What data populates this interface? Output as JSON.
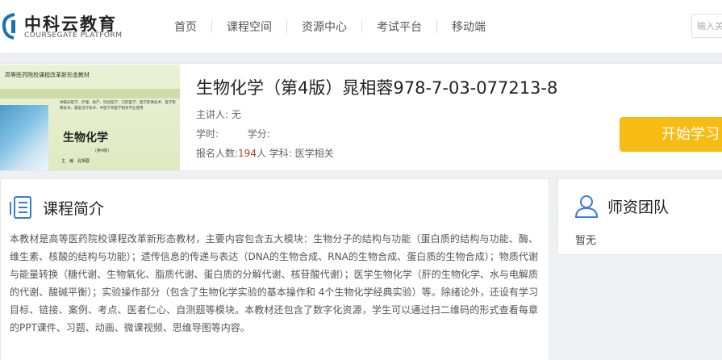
{
  "logo": {
    "cn": "中科云教育",
    "en": "COURSEGATE PLATFORM"
  },
  "nav": {
    "items": [
      "首页",
      "课程空间",
      "资源中心",
      "考试平台",
      "移动端"
    ]
  },
  "search": {
    "placeholder": "输入关键字"
  },
  "cover": {
    "series": "高等医药院校课程改革新形态教材",
    "desc": "供临床医学、护理、助产、检验医学、口腔医学、医学影像技术、医学影像技术、康复治疗技术、中医学等医学相关专业使用",
    "title": "生物化学",
    "edition": "(第4版)",
    "editor": "主　编　晁相蓉"
  },
  "course": {
    "title": "生物化学（第4版）晁相蓉978-7-03-077213-8",
    "lecturer_label": "主讲人:",
    "lecturer": "无",
    "hours_label": "学时:",
    "credits_label": "学分:",
    "enroll_label": "报名人数:",
    "enroll_count": "194",
    "enroll_unit": "人",
    "subject_label": "学科:",
    "subject": "医学相关",
    "start_button": "开始学习"
  },
  "intro": {
    "title": "课程简介",
    "text": "本教材是高等医药院校课程改革新形态教材，主要内容包含五大模块：生物分子的结构与功能（蛋白质的结构与功能、酶、维生素、核酸的结构与功能）；遗传信息的传递与表达（DNA的生物合成、RNA的生物合成、蛋白质的生物合成）；物质代谢与能量转换（糖代谢、生物氧化、脂质代谢、蛋白质的分解代谢、核苷酸代谢）；医学生物化学（肝的生物化学、水与电解质的代谢、酸碱平衡）；实验操作部分（包含了生物化学实验的基本操作和 4个生物化学经典实验）等。除绪论外，还设有学习目标、链接、案例、考点、医者仁心、自测题等模块。本教材还包含了数字化资源，学生可以通过扫二维码的形式查看每章的PPT课件、习题、动画、微课视频、思维导图等内容。"
  },
  "team": {
    "title": "师资团队",
    "empty": "暂无"
  },
  "colors": {
    "accent": "#f7bc14",
    "logo_blue": "#1a6fb5",
    "count_red": "#c0392b"
  }
}
